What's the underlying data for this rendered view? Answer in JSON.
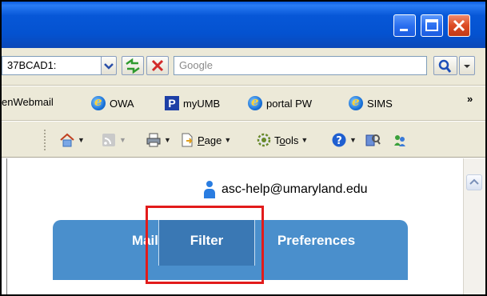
{
  "address": {
    "value": "37BCAD1:"
  },
  "search": {
    "placeholder": "Google"
  },
  "favorites": [
    "enWebmail",
    "OWA",
    "myUMB",
    "portal PW",
    "SIMS"
  ],
  "favorites_more": "»",
  "commands": {
    "page_prefix": "",
    "page_accel": "P",
    "page_rest": "age",
    "tools_prefix": "T",
    "tools_accel": "o",
    "tools_rest": "ols"
  },
  "user": {
    "email": "asc-help@umaryland.edu"
  },
  "tabs": [
    "Mail",
    "Filter",
    "Preferences"
  ],
  "colors": {
    "tab_blue": "#4a8fcc",
    "tab_active": "#3a78b4",
    "highlight": "#e21b1b"
  }
}
